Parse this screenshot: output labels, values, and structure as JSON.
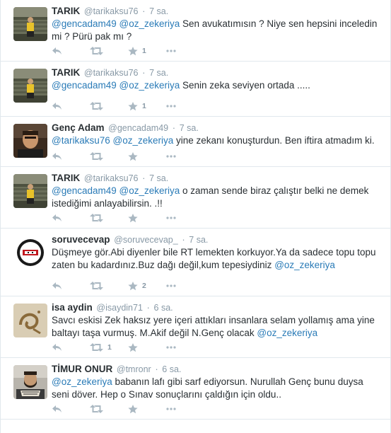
{
  "tweets": [
    {
      "fullname": "TARIK",
      "username": "@tarikaksu76",
      "time": "7 sa.",
      "parts": [
        {
          "t": "@gencadam49",
          "m": true
        },
        {
          "t": " ",
          "m": false
        },
        {
          "t": "@oz_zekeriya",
          "m": true
        },
        {
          "t": " Sen avukatımısın ? Niye sen hepsini inceledin mi ? Pürü pak mı ?",
          "m": false
        }
      ],
      "retweets": "",
      "favorites": "1",
      "avatar": "stadium"
    },
    {
      "fullname": "TARIK",
      "username": "@tarikaksu76",
      "time": "7 sa.",
      "parts": [
        {
          "t": "@gencadam49",
          "m": true
        },
        {
          "t": " ",
          "m": false
        },
        {
          "t": "@oz_zekeriya",
          "m": true
        },
        {
          "t": " Senin zeka seviyen ortada .....",
          "m": false
        }
      ],
      "retweets": "",
      "favorites": "1",
      "avatar": "stadium"
    },
    {
      "fullname": "Genç Adam",
      "username": "@gencadam49",
      "time": "7 sa.",
      "parts": [
        {
          "t": "@tarikaksu76",
          "m": true
        },
        {
          "t": " ",
          "m": false
        },
        {
          "t": "@oz_zekeriya",
          "m": true
        },
        {
          "t": " yine zekanı konuşturdun. Ben iftira atmadım ki.",
          "m": false
        }
      ],
      "retweets": "",
      "favorites": "",
      "avatar": "man"
    },
    {
      "fullname": "TARIK",
      "username": "@tarikaksu76",
      "time": "7 sa.",
      "parts": [
        {
          "t": "@gencadam49",
          "m": true
        },
        {
          "t": " ",
          "m": false
        },
        {
          "t": "@oz_zekeriya",
          "m": true
        },
        {
          "t": " o zaman sende biraz çalıştır belki ne demek istediğimi anlayabilirsin. .!!",
          "m": false
        }
      ],
      "retweets": "",
      "favorites": "",
      "avatar": "stadium"
    },
    {
      "fullname": "soruvecevap",
      "username": "@soruvecevap_",
      "time": "7 sa.",
      "parts": [
        {
          "t": "Düşmeye gör.Abi diyenler bile  RT lemekten korkuyor.Ya da sadece topu topu zaten bu kadardınız.Buz dağı değil,kum tepesiydiniz ",
          "m": false
        },
        {
          "t": "@oz_zekeriya",
          "m": true
        }
      ],
      "retweets": "",
      "favorites": "2",
      "avatar": "logo"
    },
    {
      "fullname": "isa aydin",
      "username": "@isaydin71",
      "time": "6 sa.",
      "parts": [
        {
          "t": "Savcı eskisi Zek haksız yere içeri attıkları insanlara selam yollamış ama yine baltayı taşa vurmuş. M.Akif değil N.Genç olacak ",
          "m": false
        },
        {
          "t": "@oz_zekeriya",
          "m": true
        }
      ],
      "retweets": "1",
      "favorites": "",
      "avatar": "calligraphy"
    },
    {
      "fullname": "TİMUR ONUR",
      "username": "@tmronr",
      "time": "6 sa.",
      "parts": [
        {
          "t": "@oz_zekeriya",
          "m": true
        },
        {
          "t": " babanın lafı gibi sarf ediyorsun. Nurullah Genç bunu duysa seni döver. Hep o Sınav sonuçlarını çaldığın için oldu..",
          "m": false
        }
      ],
      "retweets": "",
      "favorites": "",
      "avatar": "beard"
    }
  ],
  "colors": {
    "mention": "#2a7bb7",
    "meta": "#8899a6",
    "icon": "#aab8c2",
    "divider": "#e1e8ed"
  },
  "icons": [
    "reply-icon",
    "retweet-icon",
    "favorite-icon",
    "more-icon"
  ]
}
